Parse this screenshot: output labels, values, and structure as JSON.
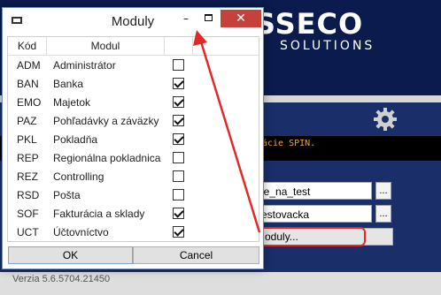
{
  "background": {
    "logo_text": "SSECO",
    "logo_sub": "SOLUTIONS",
    "console_text": "ácie SPIN.",
    "field1_value": "ie_na_test",
    "field2_value": "estovacka",
    "ellipsis_label": "...",
    "moduly_button_label": "oduly...",
    "status_text": "Verzia 5.6.5704.21450",
    "icons": {
      "settings": "gear-icon"
    }
  },
  "dialog": {
    "title": "Moduly",
    "min_glyph": "–",
    "close_glyph": "✕",
    "columns": {
      "code": "Kód",
      "module": "Modul"
    },
    "rows": [
      {
        "code": "ADM",
        "name": "Administrátor",
        "checked": false
      },
      {
        "code": "BAN",
        "name": "Banka",
        "checked": true
      },
      {
        "code": "EMO",
        "name": "Majetok",
        "checked": true
      },
      {
        "code": "PAZ",
        "name": "Pohľadávky a záväzky",
        "checked": true
      },
      {
        "code": "PKL",
        "name": "Pokladňa",
        "checked": true
      },
      {
        "code": "REP",
        "name": "Regionálna pokladnica",
        "checked": false
      },
      {
        "code": "REZ",
        "name": "Controlling",
        "checked": false
      },
      {
        "code": "RSD",
        "name": "Pošta",
        "checked": false
      },
      {
        "code": "SOF",
        "name": "Fakturácia a sklady",
        "checked": true
      },
      {
        "code": "UCT",
        "name": "Účtovníctvo",
        "checked": true
      }
    ],
    "ok_label": "OK",
    "cancel_label": "Cancel"
  },
  "colors": {
    "brand_dark": "#0b1b4d",
    "brand_band": "#1a2f6a",
    "close_red": "#c7413c",
    "annotation_red": "#e02a2a",
    "console_orange": "#f1a33a"
  }
}
